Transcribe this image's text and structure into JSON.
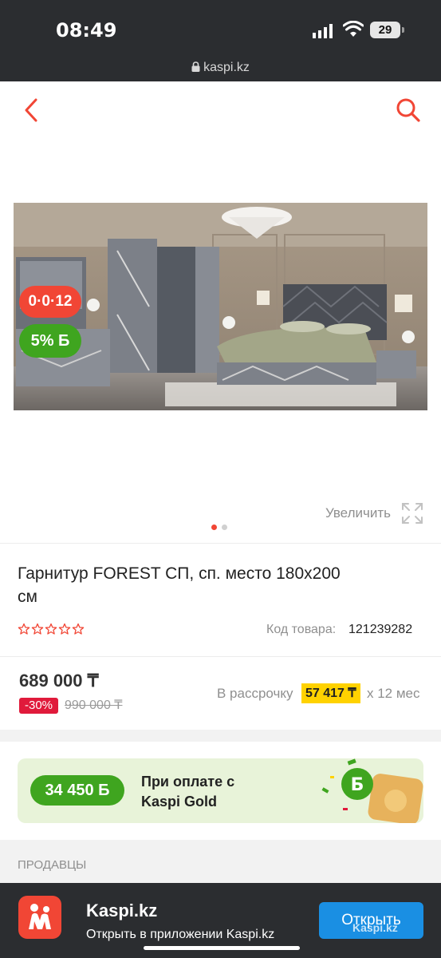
{
  "status_bar": {
    "time": "08:49",
    "battery": "29",
    "url": "kaspi.kz"
  },
  "nav": {
    "back_icon": "chevron-left-icon",
    "search_icon": "search-icon"
  },
  "gallery": {
    "badge_installment": "0·0·12",
    "badge_bonus": "5% Б",
    "zoom_label": "Увеличить",
    "dots_total": 2,
    "dots_active": 1
  },
  "product": {
    "title": "Гарнитур FOREST СП, сп. место 180x200 см",
    "rating_stars": 0,
    "sku_label": "Код товара:",
    "sku_value": "121239282"
  },
  "pricing": {
    "price": "689 000 ₸",
    "discount": "-30%",
    "old_price": "990 000 ₸",
    "installment_label": "В рассрочку",
    "installment_amount": "57 417 ₸",
    "installment_term": "x 12 мес"
  },
  "kaspi_gold": {
    "bonus_amount": "34 450 Б",
    "text": "При оплате с Kaspi Gold"
  },
  "sellers": {
    "label": "ПРОДАВЦЫ"
  },
  "app_banner": {
    "name": "Kaspi.kz",
    "subtitle": "Открыть в приложении Kaspi.kz",
    "open_label": "Открыть",
    "watermark": "Kaspi.kz"
  },
  "colors": {
    "brand_red": "#f14635",
    "bonus_green": "#3fa51f",
    "highlight_yellow": "#ffd200",
    "button_blue": "#1a8fe3"
  }
}
